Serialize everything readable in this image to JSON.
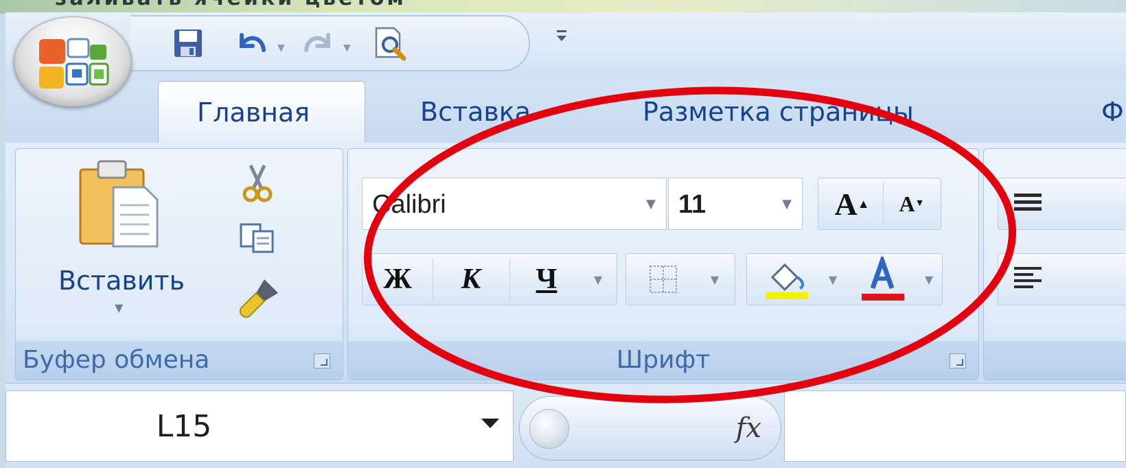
{
  "slide": {
    "caption": "заливать ячейки цветом"
  },
  "quick_access": {
    "save_icon": "save-icon",
    "undo_icon": "undo-icon",
    "redo_icon": "redo-icon",
    "print_preview_icon": "print-preview-icon",
    "customize_icon": "customize-qat-icon"
  },
  "tabs": [
    {
      "label": "Главная",
      "active": true
    },
    {
      "label": "Вставка",
      "active": false
    },
    {
      "label": "Разметка страницы",
      "active": false
    },
    {
      "label": "Ф",
      "active": false
    }
  ],
  "ribbon": {
    "clipboard": {
      "label": "Буфер обмена",
      "paste_label": "Вставить"
    },
    "font": {
      "label": "Шрифт",
      "font_name": "Calibri",
      "font_size": "11",
      "grow_label": "A",
      "shrink_label": "A",
      "bold_label": "Ж",
      "italic_label": "К",
      "underline_label": "Ч",
      "fill_color": "#f5ef00",
      "font_color": "#e0141b"
    }
  },
  "formula_bar": {
    "name_box": "L15",
    "fx_label": "fx",
    "formula_value": ""
  },
  "annotation": {
    "color": "#e3000f"
  }
}
